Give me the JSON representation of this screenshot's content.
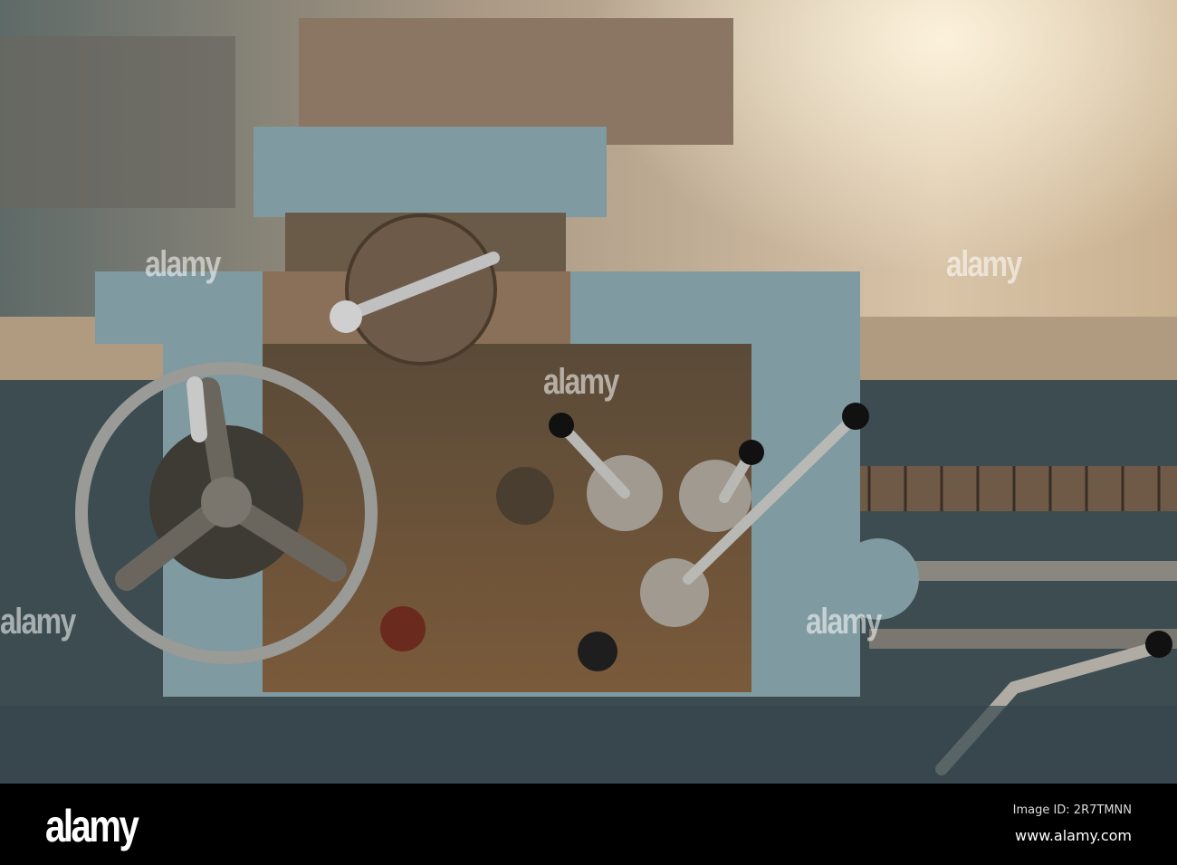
{
  "watermark": {
    "text": "alamy"
  },
  "footer": {
    "logo": "alamy",
    "image_id": "Image ID: 2R7TMNN",
    "url": "www.alamy.com"
  },
  "colors": {
    "machine_blue": "#7f9aa0",
    "rust": "#6b5238",
    "background": "#b8a48a"
  }
}
